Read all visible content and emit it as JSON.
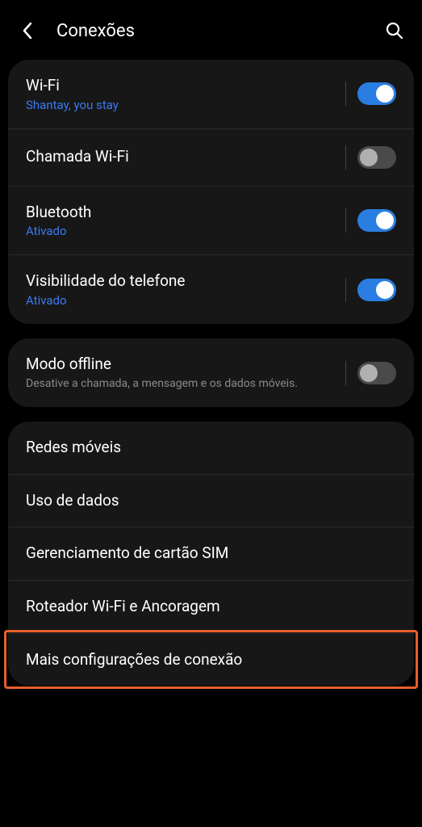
{
  "header": {
    "title": "Conexões"
  },
  "groups": [
    {
      "rows": [
        {
          "title": "Wi-Fi",
          "sub": "Shantay, you stay",
          "subStyle": "blue",
          "switch": "on"
        },
        {
          "title": "Chamada Wi-Fi",
          "switch": "off"
        },
        {
          "title": "Bluetooth",
          "sub": "Ativado",
          "subStyle": "blue",
          "switch": "on"
        },
        {
          "title": "Visibilidade do telefone",
          "sub": "Ativado",
          "subStyle": "blue",
          "switch": "on"
        }
      ]
    },
    {
      "rows": [
        {
          "title": "Modo offline",
          "sub": "Desative a chamada, a mensagem e os dados móveis.",
          "subStyle": "grey",
          "switch": "off"
        }
      ]
    },
    {
      "rows": [
        {
          "title": "Redes móveis"
        },
        {
          "title": "Uso de dados"
        },
        {
          "title": "Gerenciamento de cartão SIM"
        },
        {
          "title": "Roteador Wi-Fi e Ancoragem"
        },
        {
          "title": "Mais configurações de conexão",
          "highlight": true
        }
      ]
    }
  ]
}
